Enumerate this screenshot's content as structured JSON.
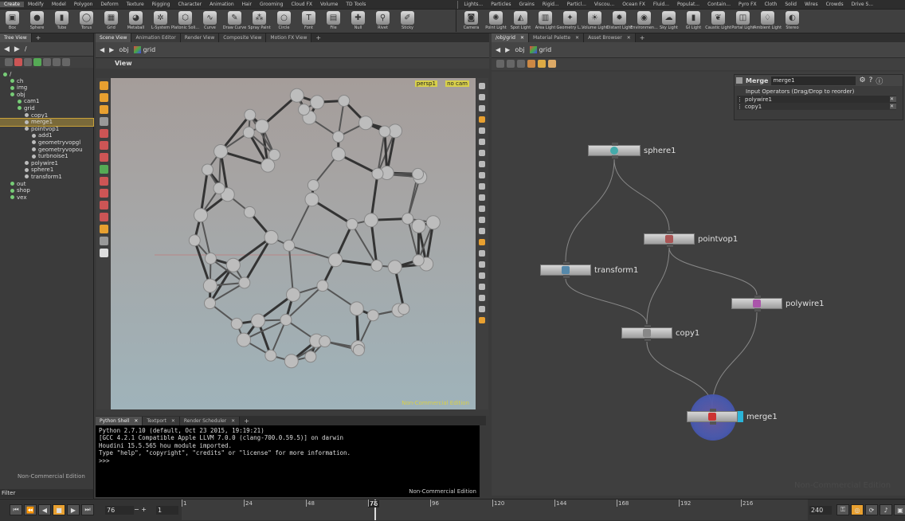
{
  "menubar_left": [
    "Create",
    "Modify",
    "Model",
    "Polygon",
    "Deform",
    "Texture",
    "Rigging",
    "Character",
    "Animation",
    "Hair",
    "Grooming",
    "Cloud FX",
    "Volume",
    "TD Tools"
  ],
  "menubar_right": [
    "Lights...",
    "Particles",
    "Grains",
    "Rigid...",
    "Particl...",
    "Viscou...",
    "Ocean FX",
    "Fluid...",
    "Populat...",
    "Contain...",
    "Pyro FX",
    "Cloth",
    "Solid",
    "Wires",
    "Crowds",
    "Drive S..."
  ],
  "shelf_left": [
    {
      "label": "Box",
      "icon": "box-icon"
    },
    {
      "label": "Sphere",
      "icon": "sphere-icon"
    },
    {
      "label": "Tube",
      "icon": "tube-icon"
    },
    {
      "label": "Torus",
      "icon": "torus-icon"
    },
    {
      "label": "Grid",
      "icon": "grid-icon"
    },
    {
      "label": "Metaball",
      "icon": "metaball-icon"
    },
    {
      "label": "L-System",
      "icon": "lsystem-icon"
    },
    {
      "label": "Platonic Soli...",
      "icon": "platonic-icon"
    },
    {
      "label": "Curve",
      "icon": "curve-icon"
    },
    {
      "label": "Draw Curve",
      "icon": "draw-curve-icon"
    },
    {
      "label": "Spray Paint",
      "icon": "spray-paint-icon"
    },
    {
      "label": "Circle",
      "icon": "circle-icon"
    },
    {
      "label": "Font",
      "icon": "font-icon"
    },
    {
      "label": "File",
      "icon": "file-icon"
    },
    {
      "label": "Null",
      "icon": "null-icon"
    },
    {
      "label": "Rivet",
      "icon": "rivet-icon"
    },
    {
      "label": "Sticky",
      "icon": "sticky-icon"
    }
  ],
  "shelf_right": [
    {
      "label": "Camera",
      "icon": "camera-icon"
    },
    {
      "label": "Point Light",
      "icon": "point-light-icon"
    },
    {
      "label": "Spot Light",
      "icon": "spot-light-icon"
    },
    {
      "label": "Area Light",
      "icon": "area-light-icon"
    },
    {
      "label": "Geometry L...",
      "icon": "geometry-light-icon"
    },
    {
      "label": "Volume Light",
      "icon": "volume-light-icon"
    },
    {
      "label": "Distant Light",
      "icon": "distant-light-icon"
    },
    {
      "label": "Environmen...",
      "icon": "environment-light-icon"
    },
    {
      "label": "Sky Light",
      "icon": "sky-light-icon"
    },
    {
      "label": "GI Light",
      "icon": "gi-light-icon"
    },
    {
      "label": "Caustic Light",
      "icon": "caustic-light-icon"
    },
    {
      "label": "Portal Light",
      "icon": "portal-light-icon"
    },
    {
      "label": "Ambient Light",
      "icon": "ambient-light-icon"
    },
    {
      "label": "Stereo",
      "icon": "stereo-icon"
    }
  ],
  "tree": {
    "tab": "Tree View",
    "path": "/",
    "items": [
      {
        "label": "/",
        "indent": 0
      },
      {
        "label": "ch",
        "indent": 1
      },
      {
        "label": "img",
        "indent": 1
      },
      {
        "label": "obj",
        "indent": 1
      },
      {
        "label": "cam1",
        "indent": 2
      },
      {
        "label": "grid",
        "indent": 2
      },
      {
        "label": "copy1",
        "indent": 3
      },
      {
        "label": "merge1",
        "indent": 3,
        "selected": true
      },
      {
        "label": "pointvop1",
        "indent": 3
      },
      {
        "label": "add1",
        "indent": 4
      },
      {
        "label": "geometryvopgl",
        "indent": 4
      },
      {
        "label": "geometryvopou",
        "indent": 4
      },
      {
        "label": "turbnoise1",
        "indent": 4
      },
      {
        "label": "polywire1",
        "indent": 3
      },
      {
        "label": "sphere1",
        "indent": 3
      },
      {
        "label": "transform1",
        "indent": 3
      },
      {
        "label": "out",
        "indent": 1
      },
      {
        "label": "shop",
        "indent": 1
      },
      {
        "label": "vex",
        "indent": 1
      }
    ],
    "watermark": "Non-Commercial Edition",
    "filter_label": "Filter"
  },
  "scene_tabs": [
    "Scene View",
    "Animation Editor",
    "Render View",
    "Composite View",
    "Motion FX View"
  ],
  "scene_path": [
    "obj",
    "grid"
  ],
  "viewport": {
    "title": "View",
    "persp": "persp1",
    "cam": "no cam",
    "watermark": "Non-Commercial Edition"
  },
  "shell": {
    "tabs": [
      "Python Shell",
      "Textport",
      "Render Scheduler"
    ],
    "lines": [
      "Python 2.7.10 (default, Oct 23 2015, 19:19:21)",
      "[GCC 4.2.1 Compatible Apple LLVM 7.0.0 (clang-700.0.59.5)] on darwin",
      "Houdini 15.5.565 hou module imported.",
      "Type \"help\", \"copyright\", \"credits\" or \"license\" for more information.",
      ">>>"
    ],
    "watermark": "Non-Commercial Edition"
  },
  "net_tabs": [
    "/obj/grid",
    "Material Palette",
    "Asset Browser"
  ],
  "net_path": [
    "obj",
    "grid"
  ],
  "params": {
    "type": "Merge",
    "name": "merge1",
    "heading": "Input Operators (Drag/Drop to reorder)",
    "inputs": [
      "polywire1",
      "copy1"
    ]
  },
  "nodes": {
    "sphere1": "sphere1",
    "pointvop1": "pointvop1",
    "transform1": "transform1",
    "polywire1": "polywire1",
    "copy1": "copy1",
    "merge1": "merge1"
  },
  "net_watermark": "Non-Commercial Edition",
  "timeline": {
    "frame": "76",
    "start": "1",
    "end": "240",
    "marks": [
      "1",
      "24",
      "48",
      "72",
      "96",
      "120",
      "144",
      "168",
      "192",
      "216"
    ],
    "current": "76"
  },
  "colors": {
    "selected_tree": "#7a6a3a",
    "merge_ring": "#5a6ac0",
    "merge_flag": "#2ab4d8",
    "watermark": "#c8d24a"
  }
}
